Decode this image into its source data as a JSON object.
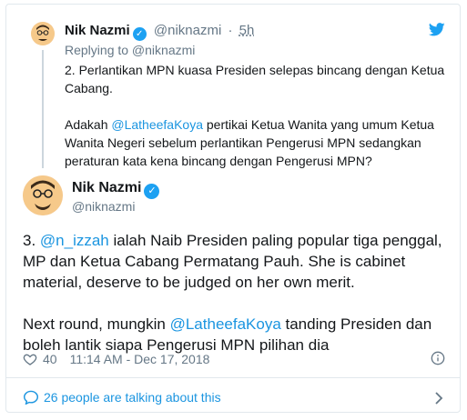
{
  "parent_tweet": {
    "name": "Nik Nazmi",
    "handle": "@niknazmi",
    "separator": "·",
    "time": "5h",
    "replying_to": "Replying to @niknazmi",
    "line1": "2. Perlantikan MPN kuasa Presiden selepas bincang dengan Ketua Cabang.",
    "line2_pre": "Adakah ",
    "line2_mention": "@LatheefaKoya",
    "line2_post": " pertikai Ketua Wanita yang umum Ketua Wanita Negeri sebelum perlantikan Pengerusi MPN sedangkan peraturan kata kena bincang dengan Pengerusi MPN?"
  },
  "main_tweet": {
    "name": "Nik Nazmi",
    "handle": "@niknazmi",
    "p1_pre": "3. ",
    "p1_mention": "@n_izzah",
    "p1_post": " ialah Naib Presiden paling popular tiga penggal, MP dan Ketua Cabang Permatang Pauh. She is cabinet material, deserve to be judged on her own merit.",
    "p2_pre": "Next round, mungkin ",
    "p2_mention": "@LatheefaKoya",
    "p2_post": " tanding Presiden dan boleh lantik siapa Pengerusi MPN pilihan dia",
    "likes": "40",
    "timestamp": "11:14 AM - Dec 17, 2018"
  },
  "footer": {
    "talking": "26 people are talking about this"
  },
  "icons": {
    "verified": "verified-icon",
    "twitter": "twitter-bird-icon",
    "like": "heart-icon",
    "info": "info-icon",
    "conversation": "speech-bubble-icon",
    "chevron": "chevron-right-icon"
  },
  "colors": {
    "accent": "#1da1f2",
    "link": "#1b95e0",
    "muted": "#657786"
  }
}
